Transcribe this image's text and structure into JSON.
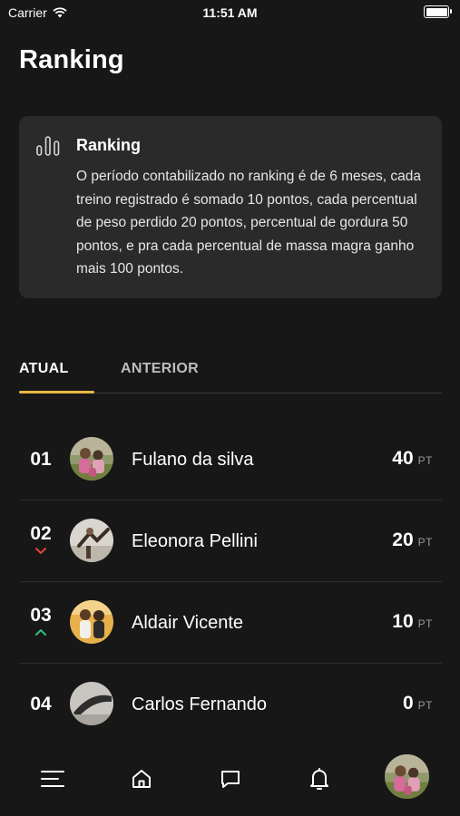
{
  "status_bar": {
    "carrier": "Carrier",
    "time": "11:51 AM"
  },
  "page": {
    "title": "Ranking"
  },
  "info_card": {
    "icon": "bar-chart-icon",
    "title": "Ranking",
    "body": "O período contabilizado no ranking é de 6 meses, cada treino registrado é somado 10 pontos, cada percentual de peso perdido 20 pontos, percentual de gordura 50 pontos, e pra cada percentual de massa magra ganho mais 100 pontos."
  },
  "tabs": [
    {
      "label": "ATUAL",
      "active": true
    },
    {
      "label": "ANTERIOR",
      "active": false
    }
  ],
  "ranking": [
    {
      "position": "01",
      "name": "Fulano da silva",
      "score": "40",
      "unit": "PT",
      "trend": "none"
    },
    {
      "position": "02",
      "name": "Eleonora Pellini",
      "score": "20",
      "unit": "PT",
      "trend": "down"
    },
    {
      "position": "03",
      "name": "Aldair Vicente",
      "score": "10",
      "unit": "PT",
      "trend": "up"
    },
    {
      "position": "04",
      "name": "Carlos Fernando",
      "score": "0",
      "unit": "PT",
      "trend": "none"
    }
  ],
  "colors": {
    "accent": "#e9b844",
    "trend_down": "#e0443a",
    "trend_up": "#2ec27e",
    "card_bg": "#2a2a2a",
    "background": "#171717"
  },
  "bottom_nav": {
    "items": [
      "menu-icon",
      "home-icon",
      "chat-icon",
      "bell-icon",
      "profile-avatar"
    ]
  }
}
